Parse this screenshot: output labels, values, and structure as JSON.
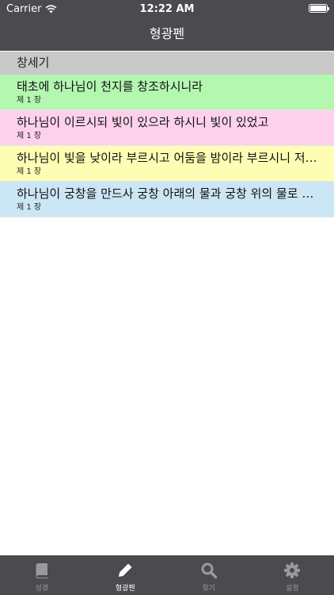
{
  "status": {
    "carrier": "Carrier",
    "time": "12:22 AM",
    "battery_level": 1.0
  },
  "nav": {
    "title": "형광펜"
  },
  "section": {
    "title": "창세기"
  },
  "colors": {
    "bar": "#4a4a4f",
    "active_tab": "#ffffff",
    "inactive_tab": "#9a9a9e",
    "green": "#b3f7b0",
    "pink": "#fdd1ec",
    "yellow": "#fefdb4",
    "blue": "#cbe6f4"
  },
  "highlights": [
    {
      "text": "태초에 하나님이 천지를 창조하시니라",
      "chapter": "제 1 장",
      "color": "#b3f7b0"
    },
    {
      "text": "하나님이 이르시되 빛이 있으라 하시니 빛이 있었고",
      "chapter": "제 1 장",
      "color": "#fdd1ec"
    },
    {
      "text": "하나님이 빛을 낮이라 부르시고 어둠을 밤이라 부르시니 저녁이 되고 아침이 되니 이는 첫째 날이니라",
      "chapter": "제 1 장",
      "color": "#fefdb4"
    },
    {
      "text": "하나님이 궁창을 만드사 궁창 아래의 물과 궁창 위의 물로 나뉘게 하시니 그대로 되니라",
      "chapter": "제 1 장",
      "color": "#cbe6f4"
    }
  ],
  "tabs": [
    {
      "label": "성경",
      "icon": "book-icon",
      "active": false
    },
    {
      "label": "형광펜",
      "icon": "pencil-icon",
      "active": true
    },
    {
      "label": "찾기",
      "icon": "search-icon",
      "active": false
    },
    {
      "label": "설정",
      "icon": "gear-icon",
      "active": false
    }
  ]
}
